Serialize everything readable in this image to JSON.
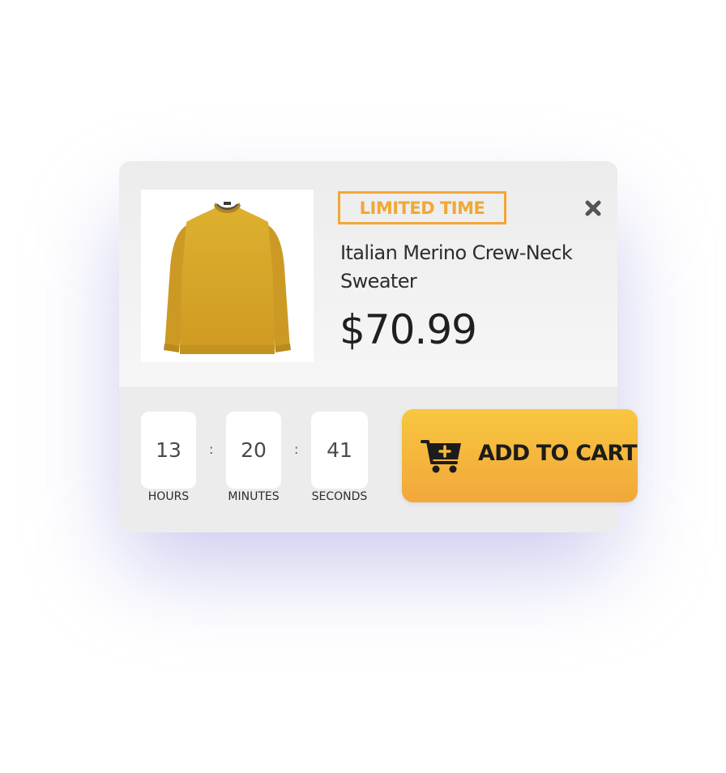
{
  "product": {
    "badge": "LIMITED TIME",
    "name": "Italian Merino Crew-Neck Sweater",
    "price": "$70.99",
    "image_icon": "sweater-image",
    "close_icon": "close-icon"
  },
  "countdown": {
    "hours": {
      "value": "13",
      "label": "HOURS"
    },
    "minutes": {
      "value": "20",
      "label": "MINUTES"
    },
    "seconds": {
      "value": "41",
      "label": "SECONDS"
    },
    "separator": ":"
  },
  "cart_button": {
    "label": "ADD TO CART",
    "icon": "add-to-cart-icon"
  },
  "colors": {
    "accent": "#f2a735",
    "button_top": "#f8c73f",
    "button_bottom": "#f2a73b",
    "sweater": "#d9a62a",
    "card_background": "#ececec"
  }
}
